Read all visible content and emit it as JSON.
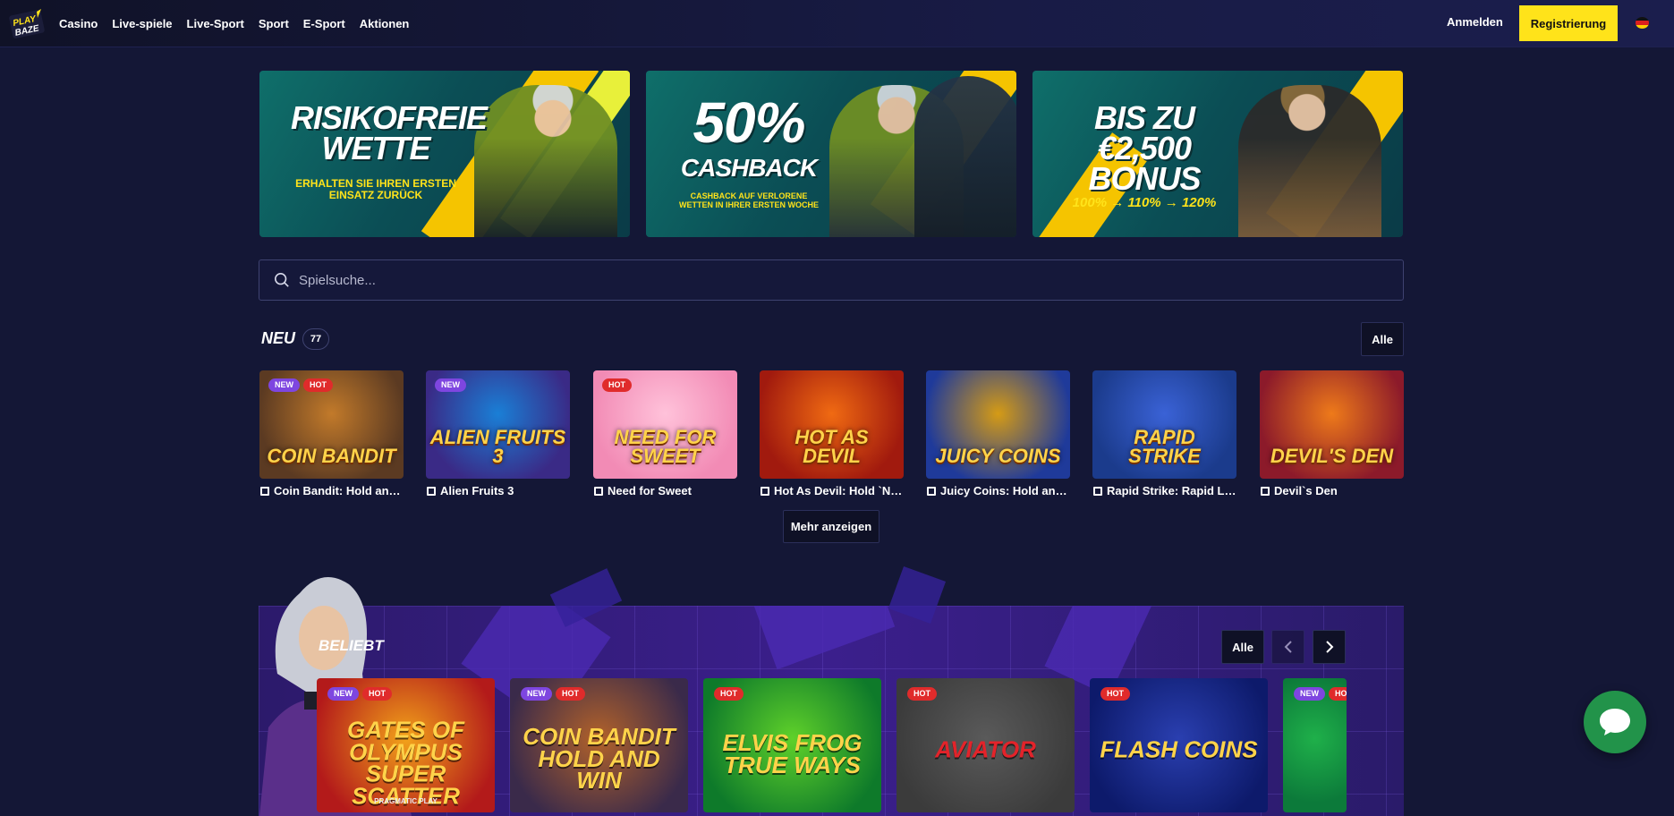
{
  "header": {
    "logo_text": [
      "PLAY",
      "BAZE"
    ],
    "nav": [
      "Casino",
      "Live-spiele",
      "Live-Sport",
      "Sport",
      "E-Sport",
      "Aktionen"
    ],
    "login_label": "Anmelden",
    "register_label": "Registrierung",
    "language": "de"
  },
  "banners": [
    {
      "headline": "RISIKOFREIE WETTE",
      "sub": "ERHALTEN SIE IHREN ERSTEN EINSATZ ZURÜCK"
    },
    {
      "headline_big": "50%",
      "headline": "CASHBACK",
      "sub": "CASHBACK AUF VERLORENE WETTEN IN IHRER ERSTEN WOCHE"
    },
    {
      "headline": "BIS ZU €2,500 BONUS",
      "sub": "100% → 110% → 120%"
    }
  ],
  "search": {
    "placeholder": "Spielsuche..."
  },
  "new_section": {
    "title": "NEU",
    "count": "77",
    "all_label": "Alle",
    "more_label": "Mehr anzeigen",
    "games": [
      {
        "name": "Coin Bandit: Hold and ...",
        "art": "COIN BANDIT",
        "badges": [
          "NEW",
          "HOT"
        ],
        "colors": [
          "#5b3a22",
          "#c27a2a"
        ]
      },
      {
        "name": "Alien Fruits 3",
        "art": "ALIEN FRUITS 3",
        "badges": [
          "NEW"
        ],
        "colors": [
          "#3a2a86",
          "#1a7fd6"
        ]
      },
      {
        "name": "Need for Sweet",
        "art": "NEED FOR SWEET",
        "badges": [
          "HOT"
        ],
        "colors": [
          "#f28bb5",
          "#ffc2da"
        ]
      },
      {
        "name": "Hot As Devil: Hold `N` L...",
        "art": "HOT AS DEVIL",
        "badges": [],
        "colors": [
          "#a11a0e",
          "#f06a12"
        ]
      },
      {
        "name": "Juicy Coins: Hold and ...",
        "art": "JUICY COINS",
        "badges": [],
        "colors": [
          "#1f3a9a",
          "#d59b15"
        ]
      },
      {
        "name": "Rapid Strike: Rapid Link",
        "art": "RAPID STRIKE",
        "badges": [],
        "colors": [
          "#1b3b8c",
          "#3a62d6"
        ]
      },
      {
        "name": "Devil`s Den",
        "art": "DEVIL'S DEN",
        "badges": [],
        "colors": [
          "#8c1a2a",
          "#ee7a1a"
        ]
      }
    ]
  },
  "popular_section": {
    "title": "BELIEBT",
    "all_label": "Alle",
    "games": [
      {
        "art": "GATES OF OLYMPUS SUPER SCATTER",
        "badges": [
          "NEW",
          "HOT"
        ],
        "provider": "PRAGMATIC PLAY",
        "colors": [
          "#b31a1a",
          "#f2a21a"
        ]
      },
      {
        "art": "COIN BANDIT HOLD AND WIN",
        "badges": [
          "NEW",
          "HOT"
        ],
        "colors": [
          "#3a2a4a",
          "#b2622a"
        ]
      },
      {
        "art": "ELVIS FROG TRUE WAYS",
        "badges": [
          "HOT"
        ],
        "colors": [
          "#0e7a2a",
          "#5fd12a"
        ]
      },
      {
        "art": "Aviator",
        "badges": [
          "HOT"
        ],
        "colors": [
          "#3b3b3b",
          "#5a5a5a"
        ]
      },
      {
        "art": "FLASH COINS",
        "badges": [
          "HOT"
        ],
        "colors": [
          "#0d1a6b",
          "#2a3fb0"
        ]
      },
      {
        "art": "",
        "badges": [
          "NEW",
          "HOT"
        ],
        "colors": [
          "#0c7a3a",
          "#1fb04a"
        ]
      }
    ]
  },
  "accent": "#ffe31a"
}
